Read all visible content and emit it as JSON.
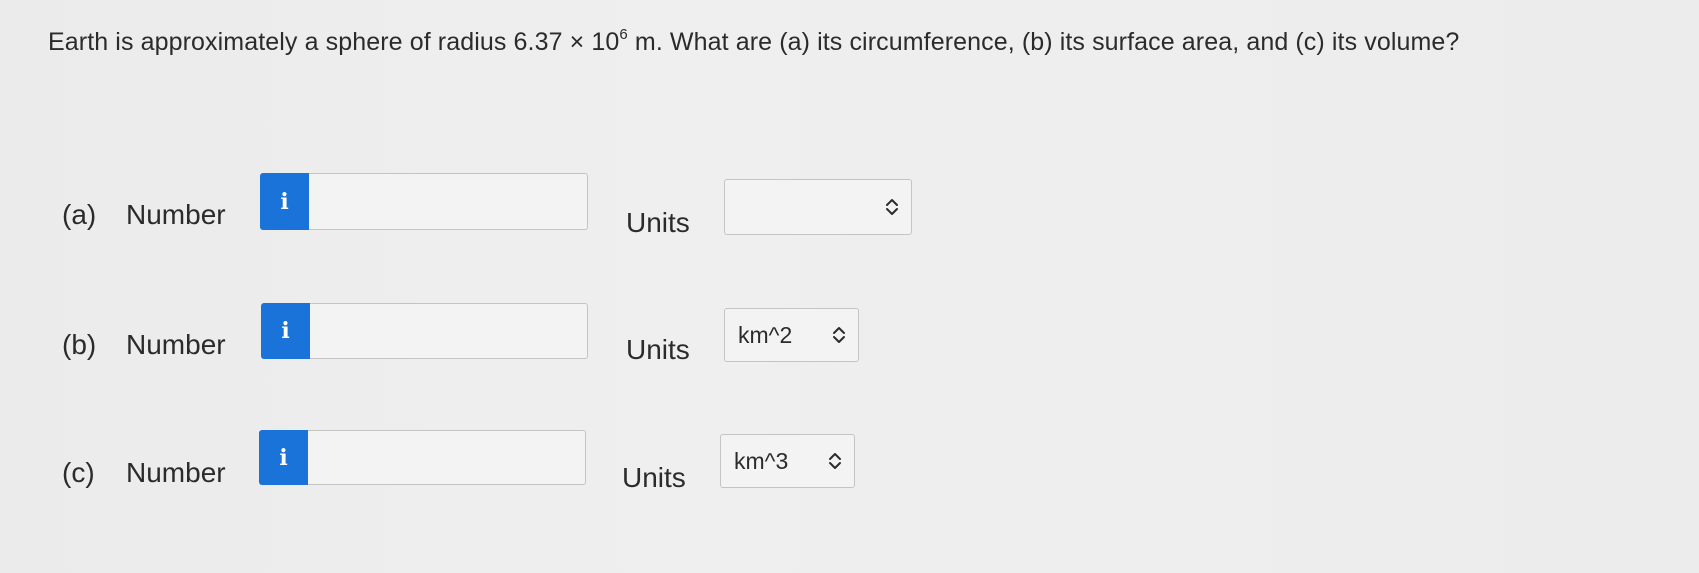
{
  "question": {
    "before_exp": "Earth is approximately a sphere of radius 6.37 × 10",
    "exponent": "6",
    "after_exp": " m. What are (a) its circumference, (b) its surface area, and (c) its volume?"
  },
  "rows": [
    {
      "part": "(a)",
      "label": "Number",
      "info_icon": "i",
      "value": "",
      "units_label": "Units",
      "unit": ""
    },
    {
      "part": "(b)",
      "label": "Number",
      "info_icon": "i",
      "value": "",
      "units_label": "Units",
      "unit": "km^2"
    },
    {
      "part": "(c)",
      "label": "Number",
      "info_icon": "i",
      "value": "",
      "units_label": "Units",
      "unit": "km^3"
    }
  ],
  "colors": {
    "info_button": "#1a73d9",
    "background": "#ededed",
    "text": "#2b2b2b"
  },
  "icons": {
    "info": "info-icon",
    "select": "chevron-up-down-icon"
  }
}
